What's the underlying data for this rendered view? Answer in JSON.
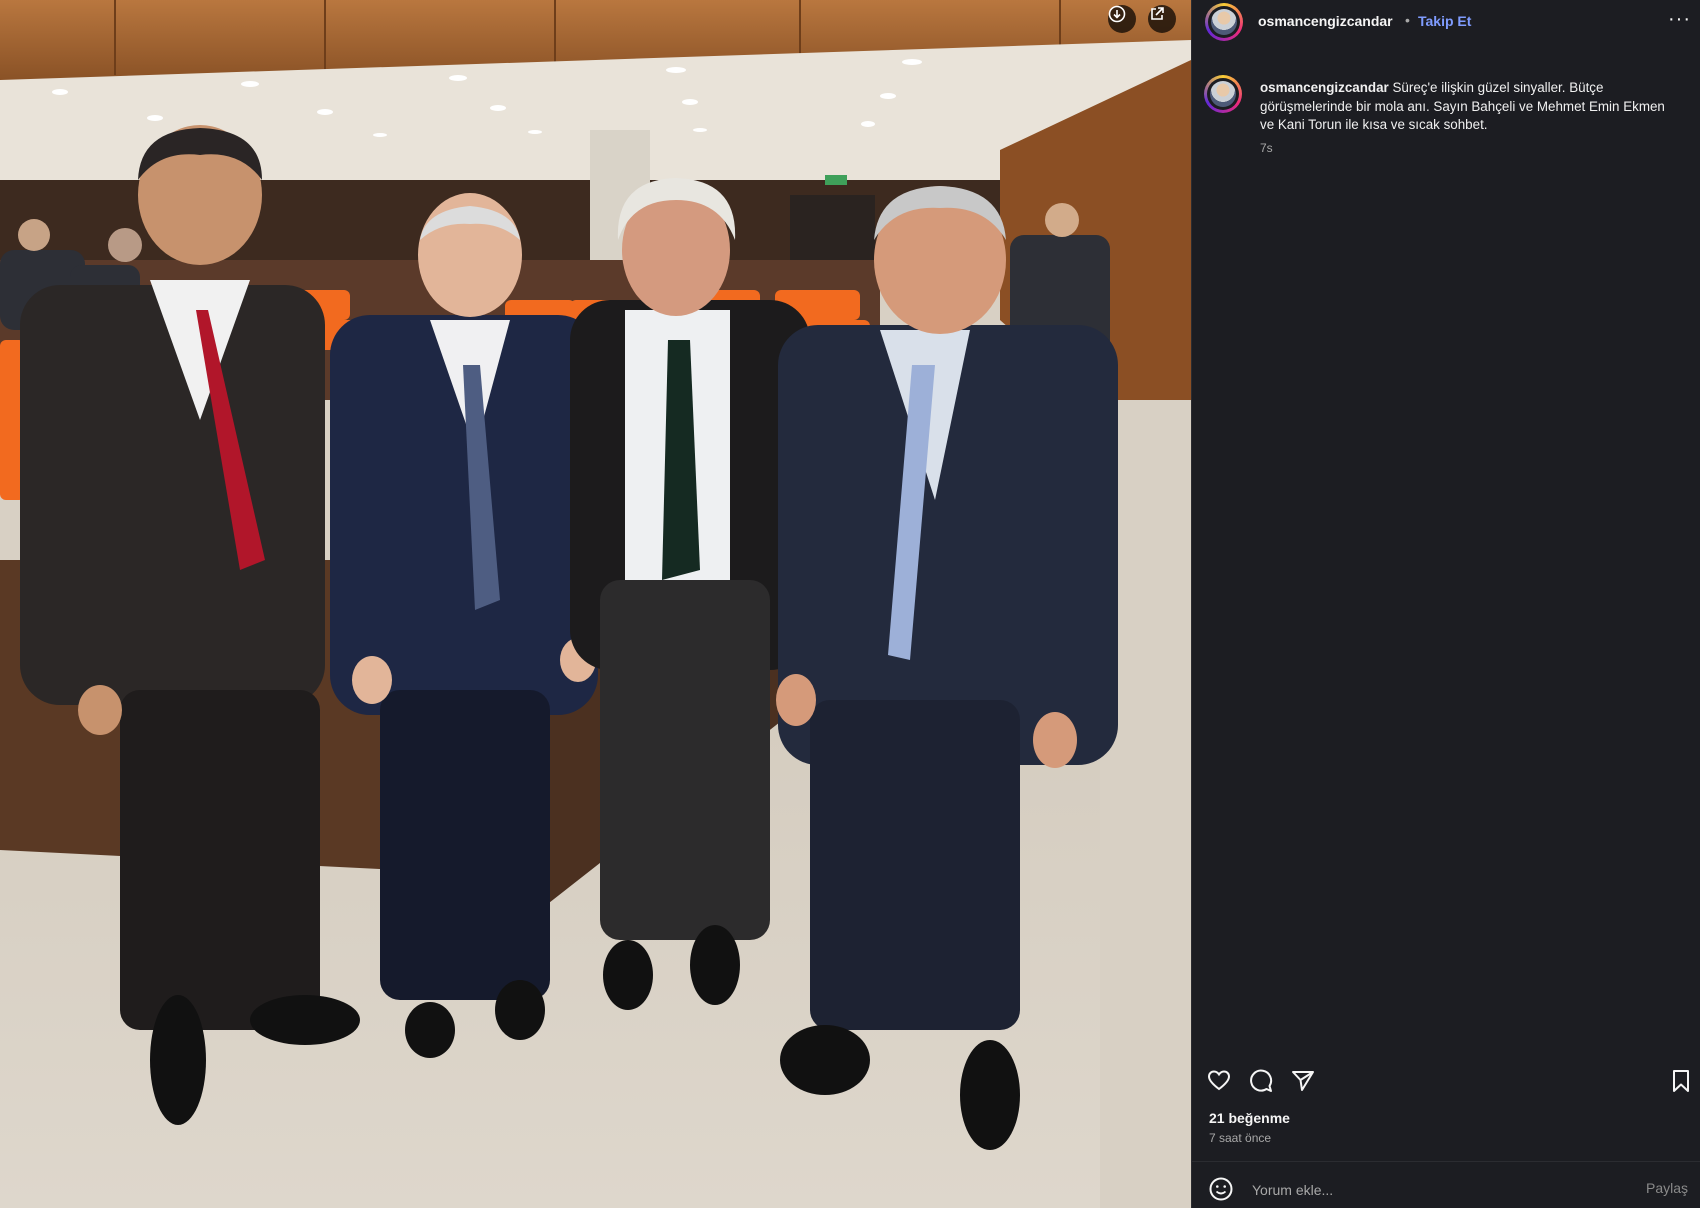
{
  "post": {
    "username": "osmancengizcandar",
    "separator": "•",
    "follow_label": "Takip Et",
    "more_label": "···",
    "caption_user": "osmancengizcandar",
    "caption_text": "Süreç'e ilişkin güzel sinyaller. Bütçe görüşmelerinde bir mola anı. Sayın Bahçeli ve Mehmet Emin Ekmen ve Kani Torun ile kısa ve sıcak sohbet.",
    "caption_time": "7s",
    "likes": "21 beğenme",
    "time_ago": "7 saat önce"
  },
  "comment": {
    "placeholder": "Yorum ekle...",
    "share_label": "Paylaş"
  },
  "icons": {
    "download": "download-icon",
    "open_external": "external-link-icon",
    "like": "heart-icon",
    "comment": "comment-icon",
    "share": "send-icon",
    "save": "bookmark-icon",
    "emoji": "emoji-icon"
  },
  "colors": {
    "panel_bg": "#1c1d22",
    "accent": "#7f9cff",
    "muted": "#a8a8a8"
  }
}
